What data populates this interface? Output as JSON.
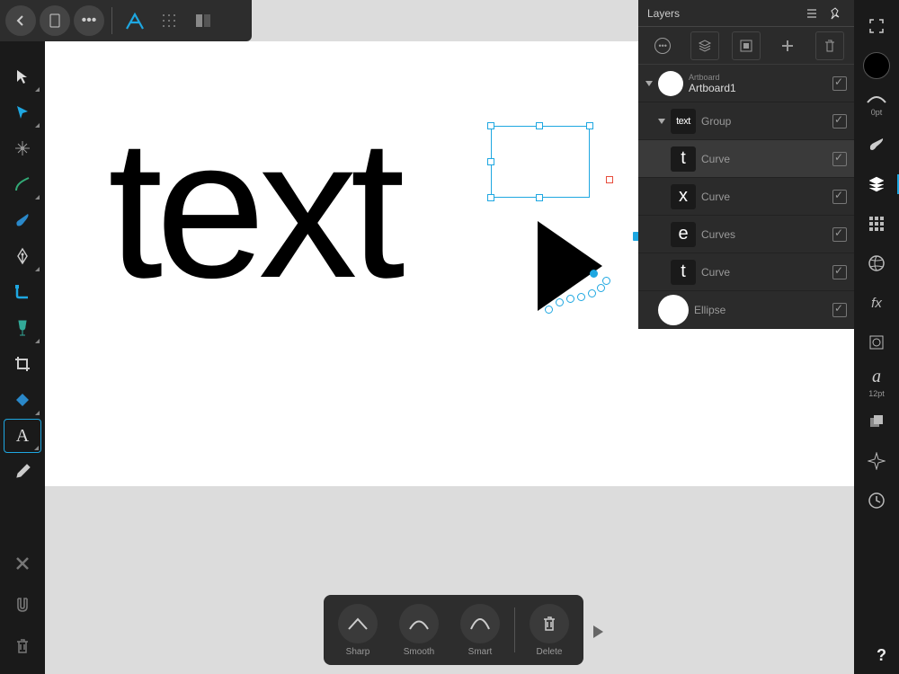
{
  "topbar": {
    "back": "‹",
    "document": "▫",
    "more": "•••"
  },
  "canvas": {
    "text": "text"
  },
  "stroke": {
    "label": "0pt"
  },
  "font": {
    "label": "12pt",
    "glyph": "a"
  },
  "layers": {
    "title": "Layers",
    "artboard_hint": "Artboard",
    "artboard_name": "Artboard1",
    "group_thumb": "text",
    "group_name": "Group",
    "items": [
      {
        "thumb": "t",
        "name": "Curve"
      },
      {
        "thumb": "x",
        "name": "Curve"
      },
      {
        "thumb": "e",
        "name": "Curves"
      },
      {
        "thumb": "t",
        "name": "Curve"
      }
    ],
    "ellipse": "Ellipse"
  },
  "context": {
    "sharp": "Sharp",
    "smooth": "Smooth",
    "smart": "Smart",
    "delete": "Delete"
  },
  "help": "?"
}
